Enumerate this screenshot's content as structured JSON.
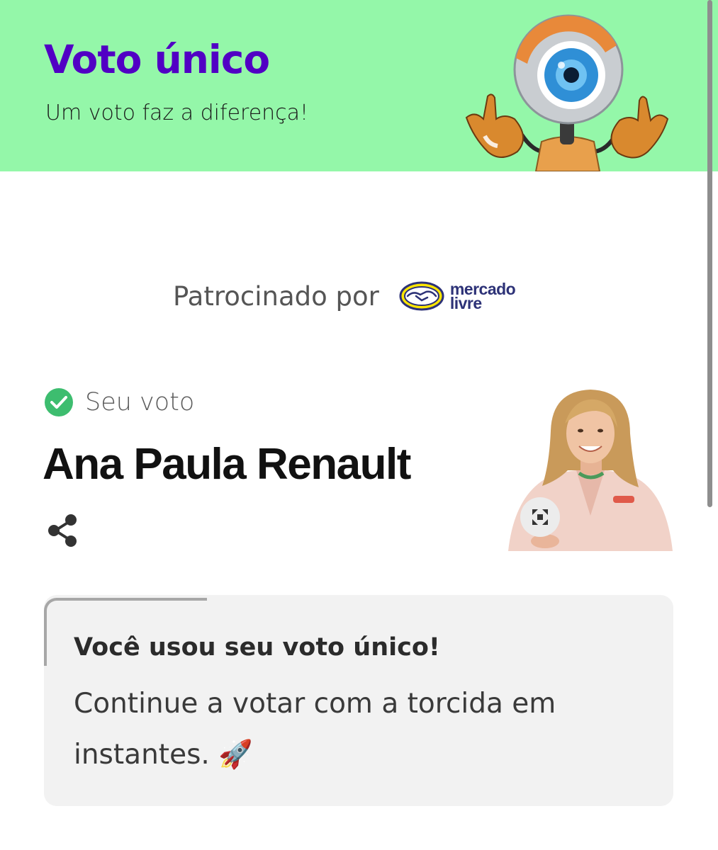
{
  "header": {
    "title": "Voto único",
    "subtitle": "Um voto faz a diferença!",
    "mascot_icon": "big-brother-eye-mascot",
    "background_color": "#94f7a9",
    "title_color": "#5100c4"
  },
  "sponsor": {
    "label": "Patrocinado por",
    "logo_line1": "mercado",
    "logo_line2": "livre",
    "logo_icon": "handshake-icon"
  },
  "vote": {
    "status_label": "Seu voto",
    "status_icon": "check-circle-icon",
    "candidate_name": "Ana Paula Renault",
    "share_icon": "share-icon",
    "expand_icon": "expand-icon",
    "photo": "candidate-photo"
  },
  "card": {
    "heading": "Você usou seu voto único!",
    "body": "Continue a votar com a torcida em instantes.",
    "body_emoji": "🚀"
  }
}
